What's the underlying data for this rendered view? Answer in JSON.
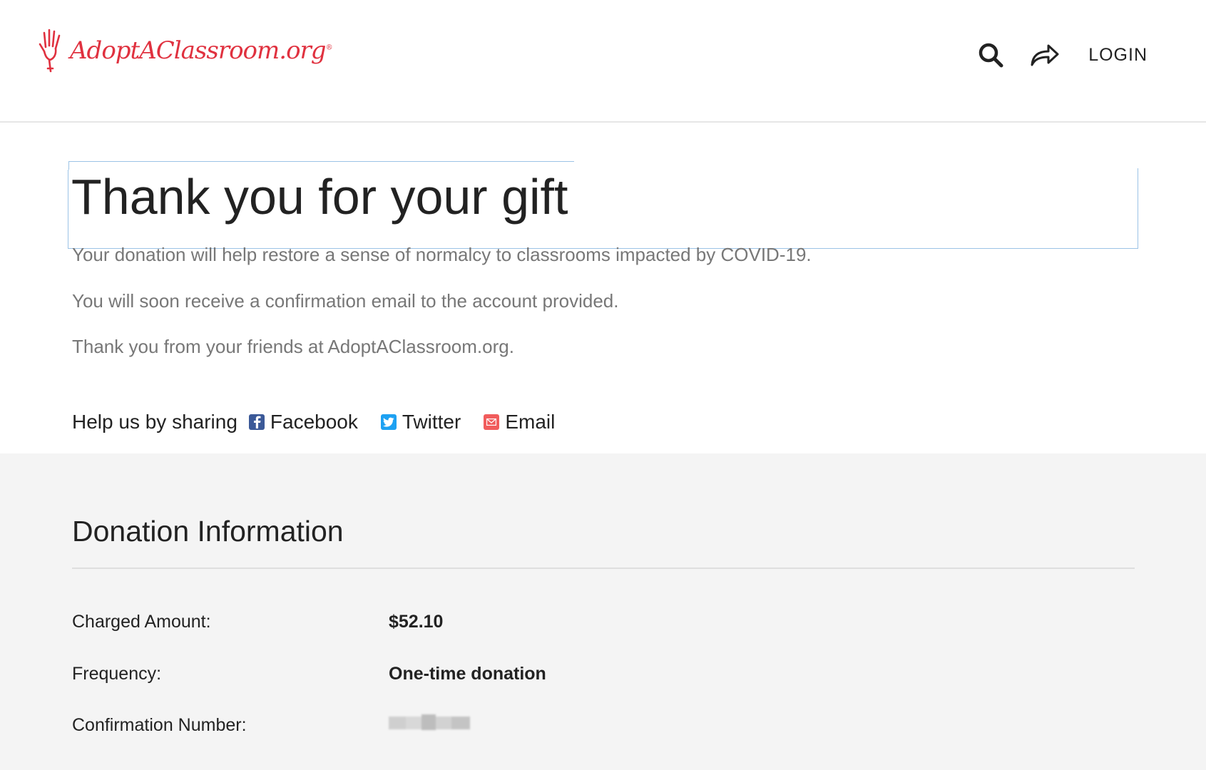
{
  "header": {
    "logo_text": "AdoptAClassroom.org",
    "logo_reg": "®",
    "login_label": "LOGIN",
    "icons": [
      "search-icon",
      "share-icon"
    ],
    "brand_color": "#e0313f"
  },
  "main": {
    "title": "Thank you for your gift",
    "paragraphs": [
      "Your donation will help restore a sense of normalcy to classrooms impacted by COVID-19.",
      "You will soon receive a confirmation email to the account provided.",
      "Thank you from your friends at AdoptAClassroom.org."
    ],
    "share": {
      "label": "Help us by sharing",
      "links": [
        {
          "label": "Facebook",
          "icon": "facebook-icon",
          "color": "#3b5998"
        },
        {
          "label": "Twitter",
          "icon": "twitter-icon",
          "color": "#1da1f2"
        },
        {
          "label": "Email",
          "icon": "email-icon",
          "color": "#f15c5c"
        }
      ]
    }
  },
  "donation": {
    "title": "Donation Information",
    "rows": [
      {
        "label": "Charged Amount:",
        "value": "$52.10"
      },
      {
        "label": "Frequency:",
        "value": "One-time donation"
      },
      {
        "label": "Confirmation Number:",
        "value": ""
      }
    ]
  }
}
